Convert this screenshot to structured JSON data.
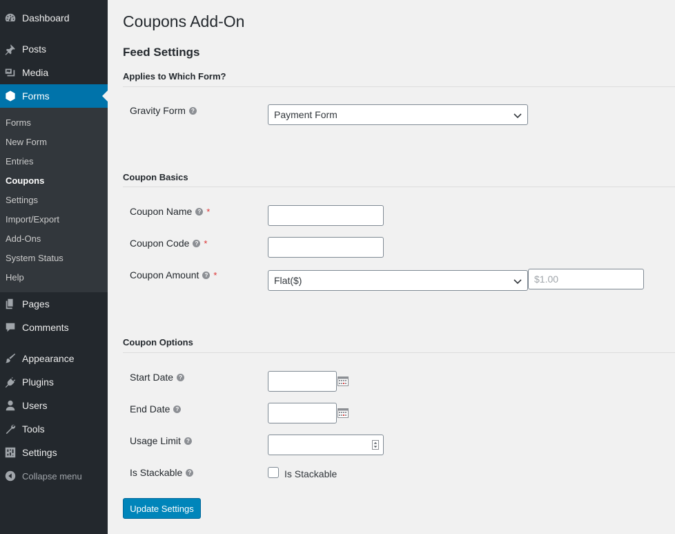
{
  "sidebar": {
    "menu": [
      {
        "label": "Dashboard",
        "icon": "dashboard-icon"
      },
      {
        "label": "Posts",
        "icon": "pin-icon"
      },
      {
        "label": "Media",
        "icon": "media-icon"
      },
      {
        "label": "Forms",
        "icon": "forms-icon"
      },
      {
        "label": "Pages",
        "icon": "pages-icon"
      },
      {
        "label": "Comments",
        "icon": "comments-icon"
      },
      {
        "label": "Appearance",
        "icon": "appearance-icon"
      },
      {
        "label": "Plugins",
        "icon": "plugins-icon"
      },
      {
        "label": "Users",
        "icon": "users-icon"
      },
      {
        "label": "Tools",
        "icon": "tools-icon"
      },
      {
        "label": "Settings",
        "icon": "settings-icon"
      }
    ],
    "submenu": [
      "Forms",
      "New Form",
      "Entries",
      "Coupons",
      "Settings",
      "Import/Export",
      "Add-Ons",
      "System Status",
      "Help"
    ],
    "collapse_label": "Collapse menu",
    "active_color": "#0073aa"
  },
  "page": {
    "title": "Coupons Add-On",
    "subtitle": "Feed Settings"
  },
  "sections": {
    "applies": {
      "title": "Applies to Which Form?",
      "gravity_form_label": "Gravity Form",
      "gravity_form_value": "Payment Form"
    },
    "basics": {
      "title": "Coupon Basics",
      "name_label": "Coupon Name",
      "code_label": "Coupon Code",
      "amount_label": "Coupon Amount",
      "amount_type": "Flat($)",
      "amount_placeholder": "$1.00"
    },
    "options": {
      "title": "Coupon Options",
      "start_date_label": "Start Date",
      "end_date_label": "End Date",
      "usage_limit_label": "Usage Limit",
      "stackable_label": "Is Stackable",
      "stackable_checkbox_label": "Is Stackable"
    }
  },
  "required_mark": "*",
  "help_glyph": "?",
  "update_button": "Update Settings"
}
